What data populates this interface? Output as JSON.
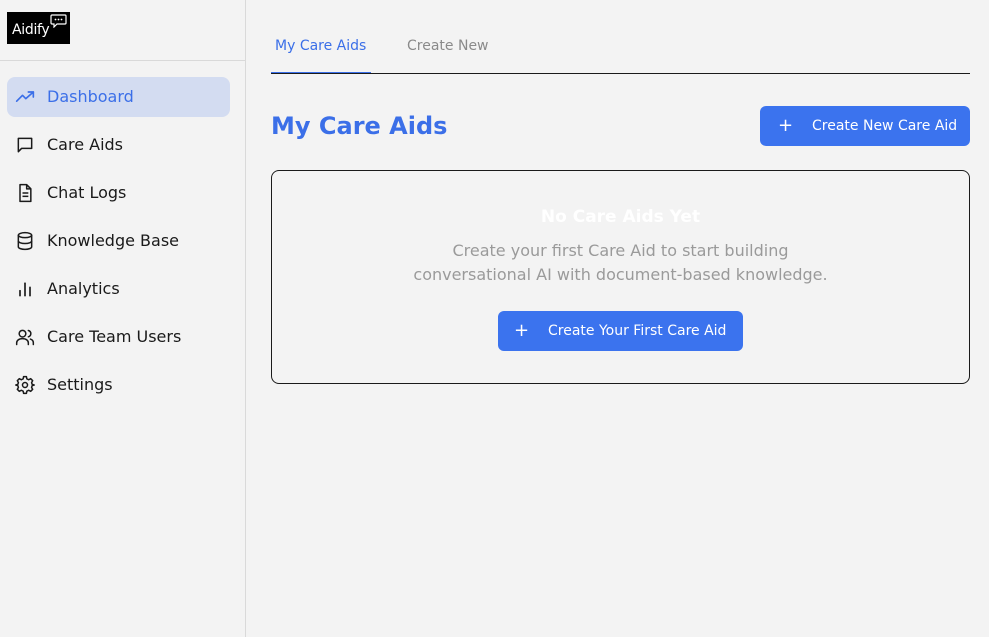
{
  "app": {
    "logo_text": "Aidify"
  },
  "sidebar": {
    "items": [
      {
        "label": "Dashboard",
        "icon": "trending-up-icon",
        "active": true
      },
      {
        "label": "Care Aids",
        "icon": "chat-bubble-icon"
      },
      {
        "label": "Chat Logs",
        "icon": "document-icon"
      },
      {
        "label": "Knowledge Base",
        "icon": "database-icon"
      },
      {
        "label": "Analytics",
        "icon": "bar-chart-icon"
      },
      {
        "label": "Care Team Users",
        "icon": "users-icon"
      },
      {
        "label": "Settings",
        "icon": "gear-icon"
      }
    ]
  },
  "tabs": [
    {
      "label": "My Care Aids",
      "active": true
    },
    {
      "label": "Create New",
      "active": false
    }
  ],
  "main": {
    "title": "My Care Aids",
    "create_button": "Create New Care Aid",
    "empty_state": {
      "title": "No Care Aids Yet",
      "description_line1": "Create your first Care Aid to start building",
      "description_line2": "conversational AI with document-based knowledge.",
      "button": "Create Your First Care Aid"
    }
  },
  "colors": {
    "accent": "#3b73ee",
    "active_bg": "#d3dcf1",
    "background": "#f3f3f3"
  }
}
